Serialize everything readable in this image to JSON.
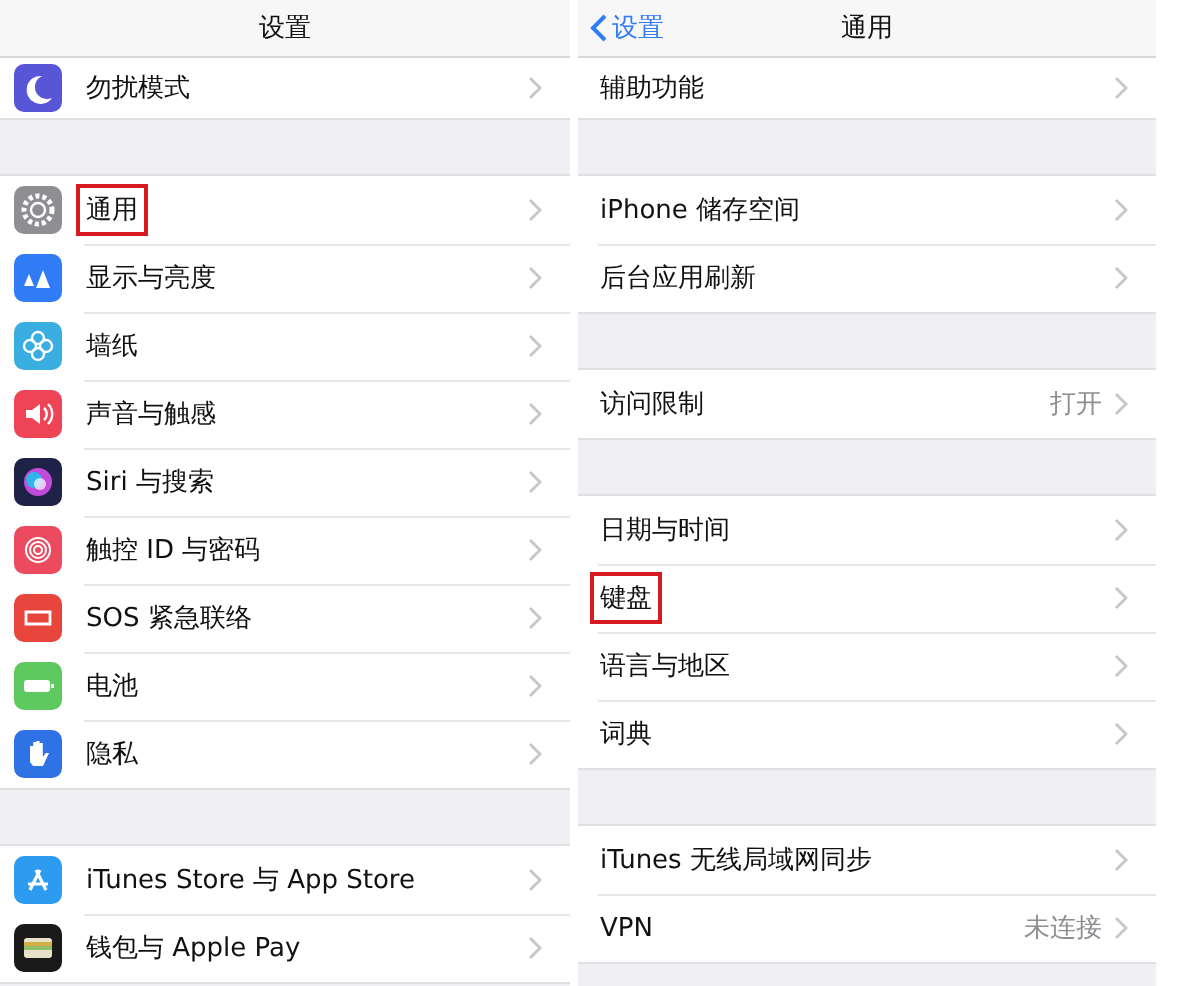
{
  "panels": [
    {
      "title": "设置",
      "sections": [
        {
          "rows": [
            {
              "label": "勿扰模式",
              "highlighted": false
            }
          ]
        },
        {
          "rows": [
            {
              "label": "通用",
              "highlighted": true
            },
            {
              "label": "显示与亮度",
              "highlighted": false
            },
            {
              "label": "墙纸",
              "highlighted": false
            },
            {
              "label": "声音与触感",
              "highlighted": false
            },
            {
              "label": "Siri 与搜索",
              "highlighted": false
            },
            {
              "label": "触控 ID 与密码",
              "highlighted": false
            },
            {
              "label": "SOS 紧急联络",
              "highlighted": false
            },
            {
              "label": "电池",
              "highlighted": false
            },
            {
              "label": "隐私",
              "highlighted": false
            }
          ]
        },
        {
          "rows": [
            {
              "label": "iTunes Store 与 App Store",
              "highlighted": false
            },
            {
              "label": "钱包与 Apple Pay",
              "highlighted": false
            }
          ]
        }
      ]
    },
    {
      "title": "通用",
      "back": "设置",
      "sections": [
        {
          "rows": [
            {
              "label": "辅助功能",
              "highlighted": false
            }
          ]
        },
        {
          "rows": [
            {
              "label": "iPhone 储存空间",
              "highlighted": false
            },
            {
              "label": "后台应用刷新",
              "highlighted": false
            }
          ]
        },
        {
          "rows": [
            {
              "label": "访问限制",
              "value": "打开",
              "highlighted": false
            }
          ]
        },
        {
          "rows": [
            {
              "label": "日期与时间",
              "highlighted": false
            },
            {
              "label": "键盘",
              "highlighted": true
            },
            {
              "label": "语言与地区",
              "highlighted": false
            },
            {
              "label": "词典",
              "highlighted": false
            }
          ]
        },
        {
          "rows": [
            {
              "label": "iTunes 无线局域网同步",
              "highlighted": false
            },
            {
              "label": "VPN",
              "value": "未连接",
              "highlighted": false
            }
          ]
        }
      ]
    }
  ]
}
